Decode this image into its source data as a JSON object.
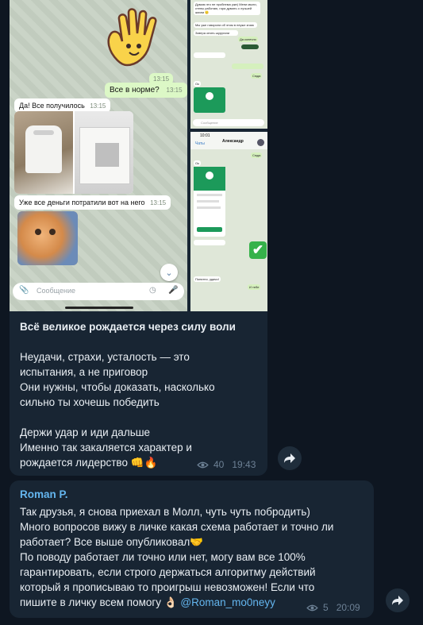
{
  "screenshot_left": {
    "bubbles": {
      "time1": "13:15",
      "out_msg": "Все в норме?",
      "out_time": "13:15",
      "in_msg1": "Да! Все получилось",
      "in_time1": "13:15",
      "in_msg2": "Уже все деньги потратили вот на него",
      "in_time2": "13:15"
    },
    "input_placeholder": "Сообщение"
  },
  "screenshot_right_top": {
    "lines": [
      "Думаю это не проблема уже) Мени мыли,",
      "стены работаю, гора думать о лучшей",
      "жизни 🙂",
      "Мы уже говорили об этом в неуже знаю",
      "Завтра опять шуругали",
      "Да конечно",
      "Сюда",
      "Ок"
    ],
    "input_placeholder": "Сообщение"
  },
  "screenshot_right_bottom": {
    "time": "10:01",
    "back": "Чаты",
    "contact": "Александр",
    "bubble1": "Сюда",
    "bubble2": "Ок",
    "bubble3": "Понятно, удачи!",
    "bubble4": "И тебе",
    "check": "✔"
  },
  "message1": {
    "title": "Всё великое рождается через силу воли",
    "para1": [
      "Неудачи, страхи, усталость — это",
      "испытания, а не приговор",
      "Они нужны, чтобы доказать, насколько",
      "сильно ты хочешь победить"
    ],
    "para2": [
      "Держи удар и иди дальше",
      "Именно так закаляется характер и",
      "рождается лидерство 👊🔥"
    ],
    "views": "40",
    "time": "19:43"
  },
  "message2": {
    "sender": "Roman P.",
    "lines": [
      "Так друзья, я снова приехал в Молл, чуть чуть побродить)",
      "Много вопросов вижу в личке какая схема работает и точно ли",
      "работает? Все выше опубликовал🤝",
      "По поводу работает ли точно или нет, могу вам все 100%",
      "гарантировать, если строго держаться алгоритму действий",
      "который я прописываю то проигрыш невозможен! Если что"
    ],
    "last_line": "пишите в личку всем помогу 👌🏻 ",
    "mention": "@Roman_mo0neyy",
    "views": "5",
    "time": "20:09"
  },
  "colors": {
    "background": "#0e1621",
    "bubble": "#182533",
    "accent": "#64b6ef",
    "meta": "#6d8195"
  },
  "icons": [
    "hand-emoji-icon",
    "chevron-down-icon",
    "attach-icon",
    "sticker-icon",
    "mic-icon",
    "eye-icon",
    "forward-icon",
    "check-emoji-icon"
  ]
}
